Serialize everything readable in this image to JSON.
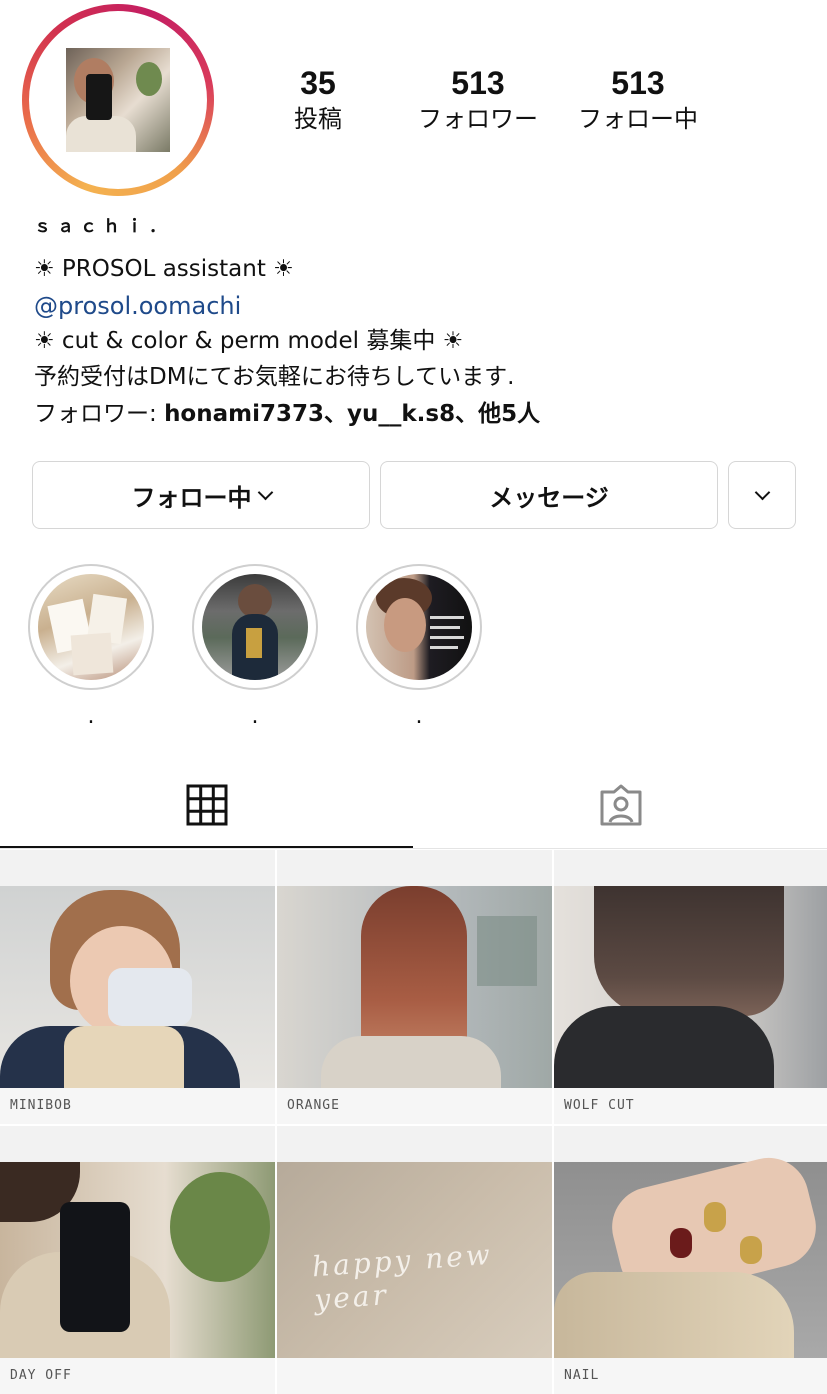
{
  "profile": {
    "username_display": "ｓａｃｈｉ．",
    "avatar_alt": "profile-photo"
  },
  "stats": {
    "posts": {
      "count": "35",
      "label": "投稿"
    },
    "followers": {
      "count": "513",
      "label": "フォロワー"
    },
    "following": {
      "count": "513",
      "label": "フォロー中"
    }
  },
  "bio": {
    "line1": "☀ PROSOL assistant  ☀",
    "link": "@prosol.oomachi",
    "line3": "☀ cut & color & perm model 募集中 ☀",
    "line4": "予約受付はDMにてお気軽にお待ちしています.",
    "followed_by_prefix": "フォロワー: ",
    "followed_by_names": "honami7373、yu__k.s8、他5人"
  },
  "buttons": {
    "following": "フォロー中",
    "message": "メッセージ",
    "more_icon": "chevron-down-icon"
  },
  "highlights": [
    {
      "label": "."
    },
    {
      "label": "."
    },
    {
      "label": "."
    }
  ],
  "tabs": {
    "grid_icon": "grid-icon",
    "tagged_icon": "tagged-person-icon",
    "active": "grid"
  },
  "posts": [
    {
      "caption": "MINIBOB"
    },
    {
      "caption": "ORANGE"
    },
    {
      "caption": "WOLF CUT"
    },
    {
      "caption": "DAY OFF"
    },
    {
      "caption": "",
      "overlay_text": "happy new year"
    },
    {
      "caption": "NAIL"
    }
  ],
  "colors": {
    "link": "#1f4a8a",
    "border": "#d6d6d6",
    "ring_start": "#f4b250",
    "ring_end": "#c41e62"
  }
}
